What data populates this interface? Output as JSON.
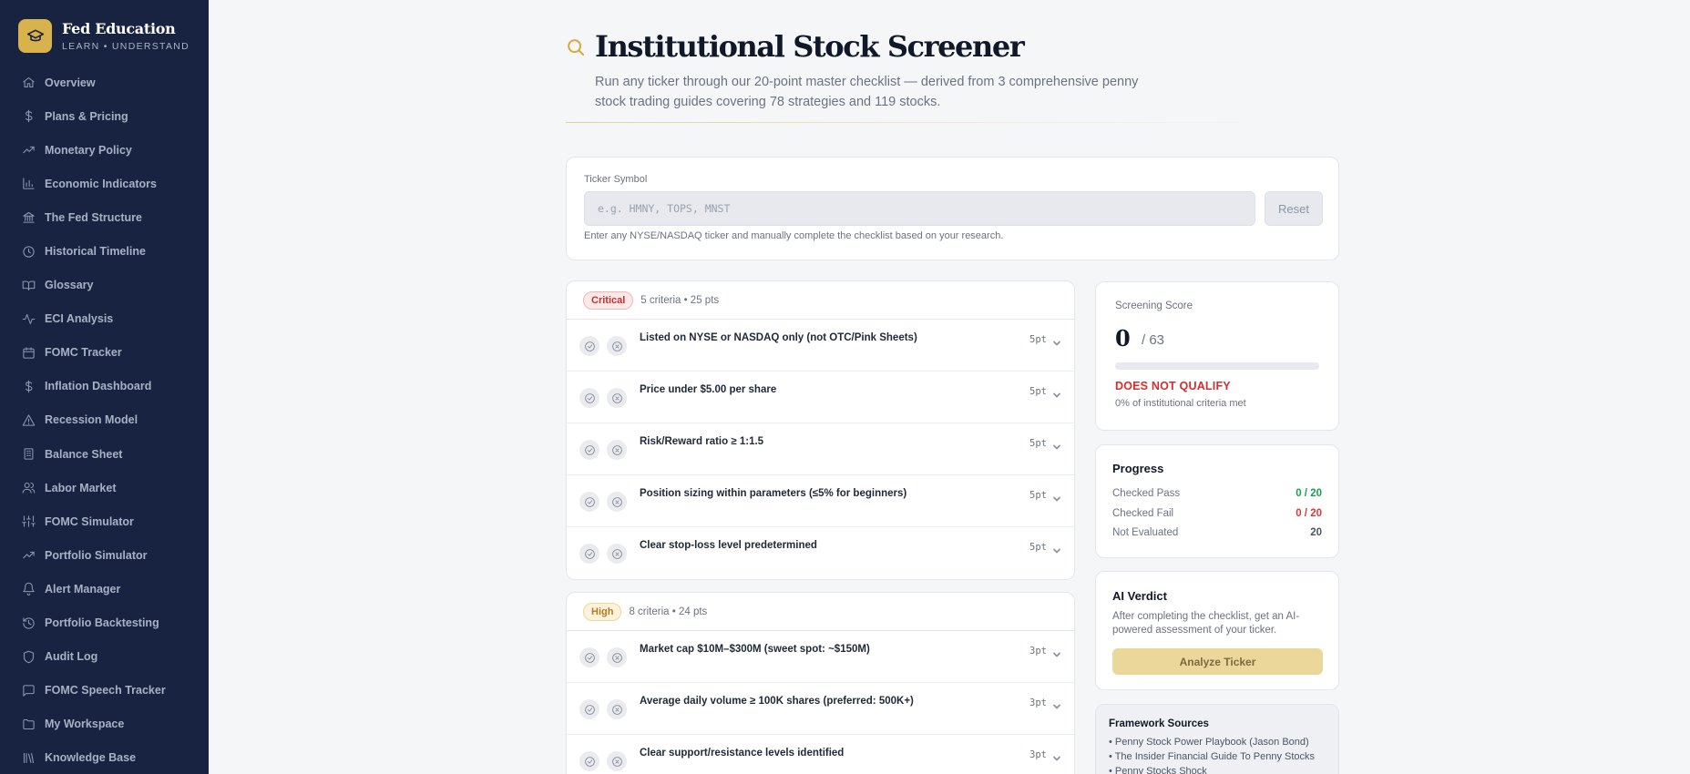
{
  "brand": {
    "title": "Fed Education",
    "subtitle": "LEARN • UNDERSTAND"
  },
  "nav": [
    {
      "label": "Overview",
      "icon": "home-icon"
    },
    {
      "label": "Plans & Pricing",
      "icon": "dollar-icon"
    },
    {
      "label": "Monetary Policy",
      "icon": "trending-up-icon"
    },
    {
      "label": "Economic Indicators",
      "icon": "bar-chart-icon"
    },
    {
      "label": "The Fed Structure",
      "icon": "bank-icon"
    },
    {
      "label": "Historical Timeline",
      "icon": "clock-icon"
    },
    {
      "label": "Glossary",
      "icon": "book-open-icon"
    },
    {
      "label": "ECI Analysis",
      "icon": "activity-icon"
    },
    {
      "label": "FOMC Tracker",
      "icon": "calendar-icon"
    },
    {
      "label": "Inflation Dashboard",
      "icon": "dollar-icon"
    },
    {
      "label": "Recession Model",
      "icon": "alert-triangle-icon"
    },
    {
      "label": "Balance Sheet",
      "icon": "building-icon"
    },
    {
      "label": "Labor Market",
      "icon": "users-icon"
    },
    {
      "label": "FOMC Simulator",
      "icon": "sliders-icon"
    },
    {
      "label": "Portfolio Simulator",
      "icon": "trending-up-icon"
    },
    {
      "label": "Alert Manager",
      "icon": "bell-icon"
    },
    {
      "label": "Portfolio Backtesting",
      "icon": "history-icon"
    },
    {
      "label": "Audit Log",
      "icon": "shield-icon"
    },
    {
      "label": "FOMC Speech Tracker",
      "icon": "message-icon"
    },
    {
      "label": "My Workspace",
      "icon": "folder-icon"
    },
    {
      "label": "Knowledge Base",
      "icon": "library-icon"
    }
  ],
  "header": {
    "title": "Institutional Stock Screener",
    "description": "Run any ticker through our 20-point master checklist — derived from 3 comprehensive penny stock trading guides covering 78 strategies and 119 stocks."
  },
  "ticker": {
    "label": "Ticker Symbol",
    "placeholder": "e.g. HMNY, TOPS, MNST",
    "value": "",
    "reset_label": "Reset",
    "help": "Enter any NYSE/NASDAQ ticker and manually complete the checklist based on your research."
  },
  "sections": [
    {
      "badge": "Critical",
      "meta": "5 criteria • 25 pts",
      "items": [
        {
          "text": "Listed on NYSE or NASDAQ only (not OTC/Pink Sheets)",
          "pts": "5pt"
        },
        {
          "text": "Price under $5.00 per share",
          "pts": "5pt"
        },
        {
          "text": "Risk/Reward ratio ≥ 1:1.5",
          "pts": "5pt"
        },
        {
          "text": "Position sizing within parameters (≤5% for beginners)",
          "pts": "5pt"
        },
        {
          "text": "Clear stop-loss level predetermined",
          "pts": "5pt"
        }
      ]
    },
    {
      "badge": "High",
      "meta": "8 criteria • 24 pts",
      "items": [
        {
          "text": "Market cap $10M–$300M (sweet spot: ~$150M)",
          "pts": "3pt"
        },
        {
          "text": "Average daily volume ≥ 100K shares (preferred: 500K+)",
          "pts": "3pt"
        },
        {
          "text": "Clear support/resistance levels identified",
          "pts": "3pt"
        }
      ]
    }
  ],
  "score": {
    "label": "Screening Score",
    "value": "0",
    "max": "/ 63",
    "fraction": 0,
    "verdict": "DOES NOT QUALIFY",
    "pct_text": "0% of institutional criteria met"
  },
  "progress": {
    "title": "Progress",
    "rows": [
      {
        "label": "Checked Pass",
        "value": "0 / 20"
      },
      {
        "label": "Checked Fail",
        "value": "0 / 20"
      },
      {
        "label": "Not Evaluated",
        "value": "20"
      }
    ]
  },
  "ai": {
    "title": "AI Verdict",
    "description": "After completing the checklist, get an AI-powered assessment of your ticker.",
    "button": "Analyze Ticker"
  },
  "sources": {
    "title": "Framework Sources",
    "items": [
      "• Penny Stock Power Playbook (Jason Bond)",
      "• The Insider Financial Guide To Penny Stocks",
      "• Penny Stocks Shock"
    ]
  },
  "colors": {
    "sidebar_bg": "#172340",
    "accent_gold": "#d8b24a",
    "pass_green": "#1e9a59",
    "fail_red": "#d33a3a"
  }
}
